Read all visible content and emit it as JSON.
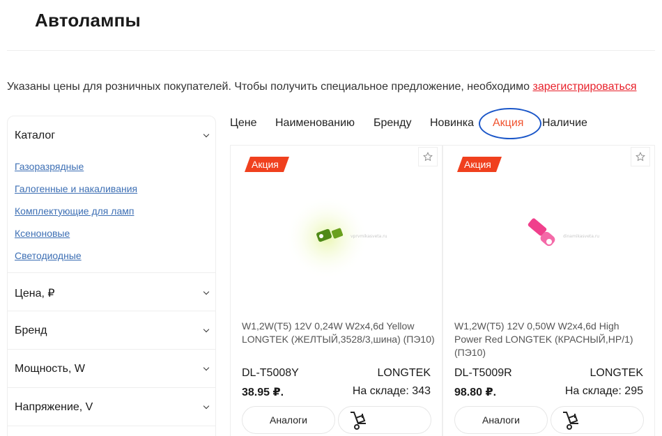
{
  "page": {
    "title": "Автолампы"
  },
  "notice": {
    "text": "Указаны цены для розничных покупателей. Чтобы получить специальное предложение, необходимо ",
    "link": "зарегистрироваться"
  },
  "sidebar": {
    "catalog_label": "Каталог",
    "categories": [
      "Газоразрядные",
      "Галогенные и накаливания",
      "Комплектующие для ламп",
      "Ксеноновые",
      "Светодиодные"
    ],
    "filters": [
      "Цена, ₽",
      "Бренд",
      "Мощность, W",
      "Напряжение, V"
    ]
  },
  "sort": {
    "items": [
      "Цене",
      "Наименованию",
      "Бренду",
      "Новинка",
      "Акция",
      "Наличие"
    ],
    "active": "Акция"
  },
  "products": [
    {
      "badge": "Акция",
      "name": "W1,2W(T5) 12V 0,24W W2x4,6d Yellow LONGTEK (ЖЕЛТЫЙ,3528/3,шина) (ПЭ10)",
      "sku": "DL-T5008Y",
      "brand": "LONGTEK",
      "price": "38.95 ₽.",
      "stock": "На складе: 343",
      "analog_label": "Аналоги",
      "image_color": "#6aa01e"
    },
    {
      "badge": "Акция",
      "name": "W1,2W(T5) 12V 0,50W W2x4,6d High Power Red LONGTEK (КРАСНЫЙ,HP/1) (ПЭ10)",
      "sku": "DL-T5009R",
      "brand": "LONGTEK",
      "price": "98.80 ₽.",
      "stock": "На складе: 295",
      "analog_label": "Аналоги",
      "image_color": "#f0408c"
    }
  ],
  "colors": {
    "accent": "#f0401e",
    "link": "#3d6fb4",
    "notice_link": "#e8202a",
    "highlight_circle": "#1a56c8"
  }
}
